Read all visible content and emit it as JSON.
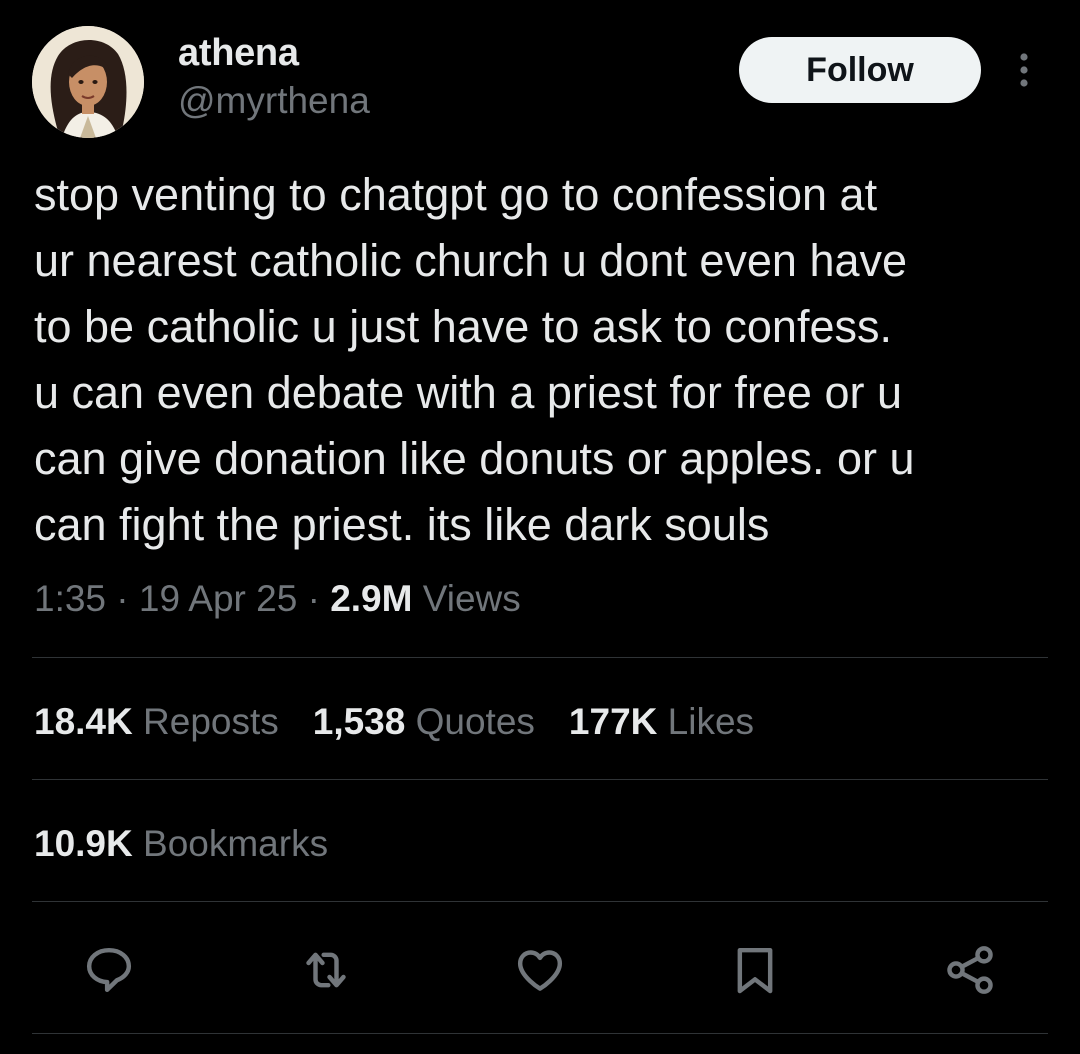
{
  "author": {
    "display_name": "athena",
    "handle": "@myrthena"
  },
  "follow_label": "Follow",
  "tweet": {
    "lines": [
      "stop venting to chatgpt go to confession at",
      "ur nearest catholic church u dont even have",
      "to be catholic u just have to ask to confess.",
      "u can even debate with a priest for free or u",
      "can give donation like donuts or apples. or u",
      "can fight the priest. its like dark souls"
    ]
  },
  "meta": {
    "time": "1:35",
    "date": "19 Apr 25",
    "views_count": "2.9M",
    "views_label": "Views"
  },
  "stats": {
    "reposts_count": "18.4K",
    "reposts_label": "Reposts",
    "quotes_count": "1,538",
    "quotes_label": "Quotes",
    "likes_count": "177K",
    "likes_label": "Likes",
    "bookmarks_count": "10.9K",
    "bookmarks_label": "Bookmarks"
  },
  "actions": [
    "reply-icon",
    "repost-icon",
    "like-icon",
    "bookmark-icon",
    "share-icon"
  ],
  "colors": {
    "background": "#000000",
    "text_primary": "#e7e9ea",
    "text_secondary": "#71767b",
    "divider": "#2f3336",
    "follow_bg": "#eff3f4"
  }
}
